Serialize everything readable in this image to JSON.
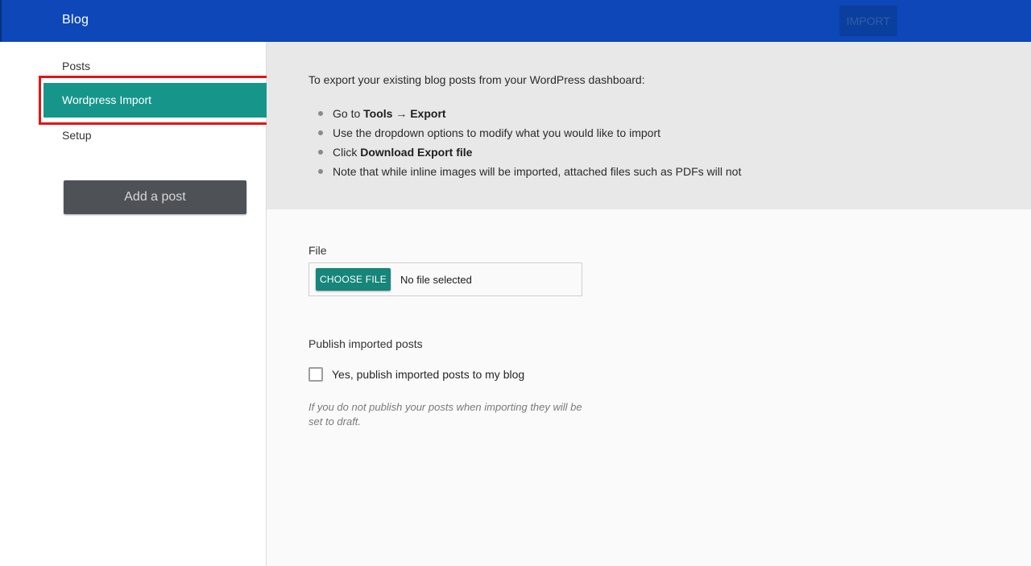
{
  "header": {
    "title": "Blog",
    "import_label": "IMPORT"
  },
  "sidebar": {
    "items": [
      {
        "label": "Posts"
      },
      {
        "label": "Wordpress Import"
      },
      {
        "label": "Setup"
      }
    ],
    "add_post_label": "Add a post"
  },
  "info": {
    "intro": "To export your existing blog posts from your WordPress dashboard:",
    "step1": {
      "prefix": "Go to ",
      "tools": "Tools",
      "arrow": " → ",
      "export": "Export"
    },
    "step2": "Use the dropdown options to modify what you would like to import",
    "step3": {
      "prefix": "Click ",
      "bold": "Download Export file"
    },
    "step4": "Note that while inline images will be imported, attached files such as PDFs will not"
  },
  "form": {
    "file_label": "File",
    "choose_file_label": "CHOOSE FILE",
    "file_status": "No file selected",
    "publish_label": "Publish imported posts",
    "publish_checkbox_label": "Yes, publish imported posts to my blog",
    "publish_checked": false,
    "publish_hint": "If you do not publish your posts when importing they will be set to draft."
  },
  "colors": {
    "topbar": "#0d47b8",
    "accent": "#16968a",
    "highlight_frame": "#e31515",
    "add_post_button": "#4e5257"
  }
}
